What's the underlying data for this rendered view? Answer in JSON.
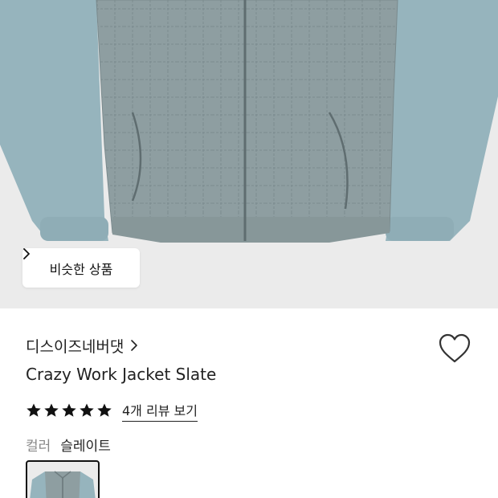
{
  "hero": {
    "image": "slate-quilted-work-jacket",
    "similar_button_label": "비슷한 상품",
    "similar_button_icon": "chevron-right-icon"
  },
  "product": {
    "brand": "디스이즈네버댓",
    "brand_icon": "chevron-right-icon",
    "title": "Crazy Work Jacket Slate",
    "rating_stars": 5,
    "review_link": "4개 리뷰 보기",
    "wishlist_icon": "heart-outline-icon",
    "color_label": "컬러",
    "color_value": "슬레이트",
    "swatch_image": "slate-jacket-thumbnail"
  },
  "colors": {
    "hero_bg": "#ebebeb",
    "body_quilt": "#8e9ea1",
    "sleeve": "#96b4bd",
    "text": "#222222",
    "muted": "#888888"
  }
}
